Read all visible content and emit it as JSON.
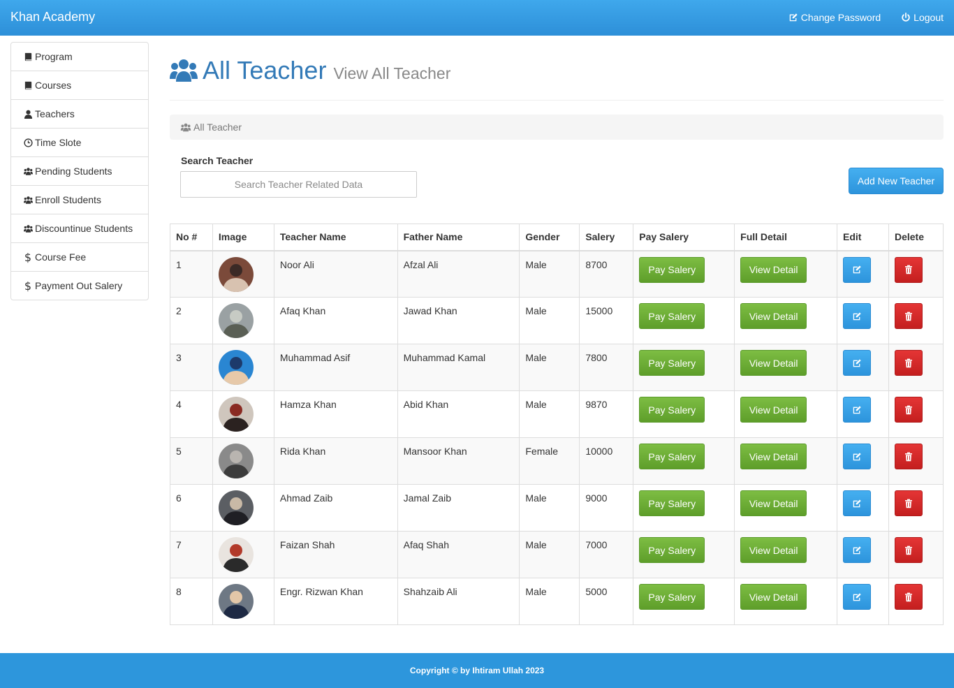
{
  "navbar": {
    "brand": "Khan Academy",
    "change_password": "Change Password",
    "logout": "Logout"
  },
  "sidebar": {
    "items": [
      {
        "label": "Program",
        "icon": "book-icon"
      },
      {
        "label": "Courses",
        "icon": "book-icon"
      },
      {
        "label": "Teachers",
        "icon": "user-icon"
      },
      {
        "label": "Time Slote",
        "icon": "clock-icon"
      },
      {
        "label": "Pending Students",
        "icon": "users-icon"
      },
      {
        "label": "Enroll Students",
        "icon": "users-icon"
      },
      {
        "label": "Discountinue Students",
        "icon": "users-icon"
      },
      {
        "label": "Course Fee",
        "icon": "dollar-icon"
      },
      {
        "label": "Payment Out Salery",
        "icon": "dollar-icon"
      }
    ]
  },
  "page": {
    "title": "All Teacher",
    "subtitle": "View All Teacher",
    "breadcrumb": "All Teacher"
  },
  "search": {
    "label": "Search Teacher",
    "placeholder": "Search Teacher Related Data"
  },
  "add_button": "Add New Teacher",
  "table": {
    "headers": {
      "no": "No #",
      "image": "Image",
      "name": "Teacher Name",
      "father": "Father Name",
      "gender": "Gender",
      "salery": "Salery",
      "pay": "Pay Salery",
      "detail": "Full Detail",
      "edit": "Edit",
      "delete": "Delete"
    },
    "pay_label": "Pay Salery",
    "detail_label": "View Detail",
    "rows": [
      {
        "no": "1",
        "name": "Noor Ali",
        "father": "Afzal Ali",
        "gender": "Male",
        "salery": "8700"
      },
      {
        "no": "2",
        "name": "Afaq Khan",
        "father": "Jawad Khan",
        "gender": "Male",
        "salery": "15000"
      },
      {
        "no": "3",
        "name": "Muhammad Asif",
        "father": "Muhammad Kamal",
        "gender": "Male",
        "salery": "7800"
      },
      {
        "no": "4",
        "name": "Hamza Khan",
        "father": "Abid Khan",
        "gender": "Male",
        "salery": "9870"
      },
      {
        "no": "5",
        "name": "Rida Khan",
        "father": "Mansoor Khan",
        "gender": "Female",
        "salery": "10000"
      },
      {
        "no": "6",
        "name": "Ahmad Zaib",
        "father": "Jamal Zaib",
        "gender": "Male",
        "salery": "9000"
      },
      {
        "no": "7",
        "name": "Faizan Shah",
        "father": "Afaq Shah",
        "gender": "Male",
        "salery": "7000"
      },
      {
        "no": "8",
        "name": "Engr. Rizwan Khan",
        "father": "Shahzaib Ali",
        "gender": "Male",
        "salery": "5000"
      }
    ]
  },
  "footer": "Copyright © by Ihtiram Ullah 2023",
  "colors": {
    "primary": "#337ab7",
    "navbar": "#2d8fd8",
    "success": "#6aab34",
    "danger": "#d12828",
    "footer": "#2d96dc"
  }
}
